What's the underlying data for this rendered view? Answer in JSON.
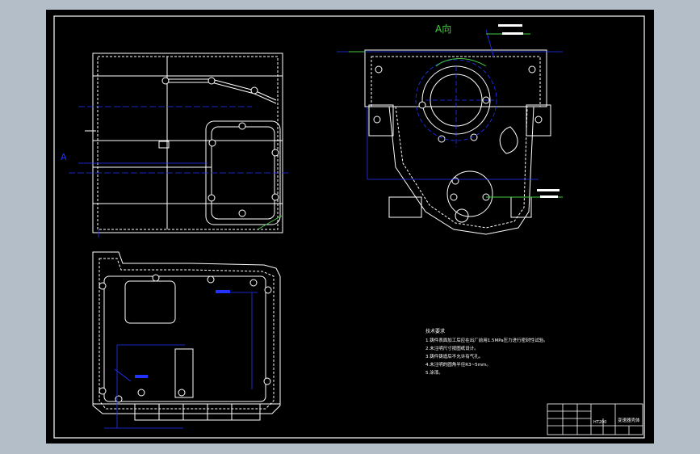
{
  "drawing": {
    "view_label_a": "A",
    "view_title": "A向",
    "notes": {
      "title": "技术要求",
      "lines": [
        "1.铸件表面加工后应在出厂前用1.5MPa压力进行密封性试验。",
        "2.未注明尺寸按图纸设计。",
        "3.铸件铸造后不允许有气孔。",
        "4.未注明的圆角半径R3~5mm。",
        "5.涂漆。"
      ]
    },
    "title_block": {
      "part_name": "变速器壳体",
      "material": "HT200"
    },
    "colors": {
      "frame": "#ffffff",
      "outline": "#ffffff",
      "dimension": "#2233ff",
      "center": "#2233ff",
      "leader": "#44cc44",
      "accent": "#dd44dd"
    }
  }
}
